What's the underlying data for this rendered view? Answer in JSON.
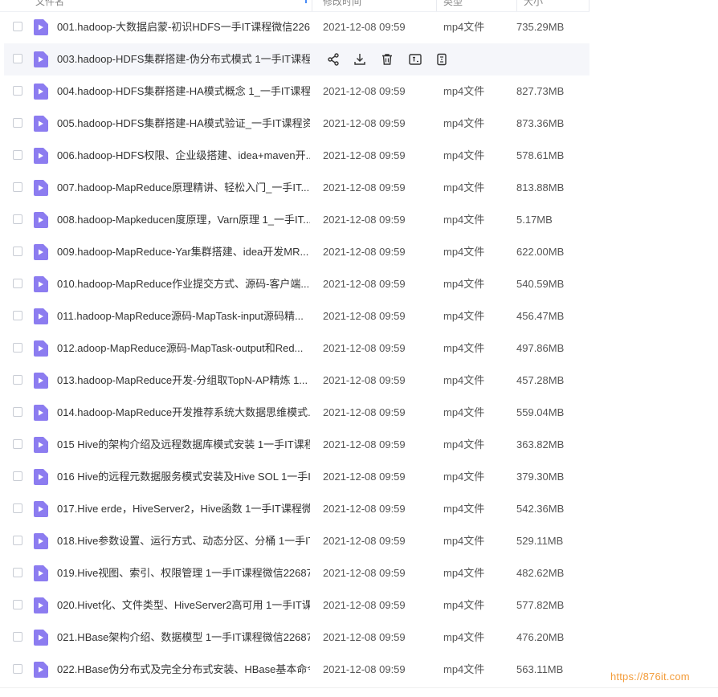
{
  "header": {
    "col_name": "文件名",
    "col_modified": "修改时间",
    "col_type": "类型",
    "col_size": "大小"
  },
  "actions": {
    "share": "share-icon",
    "download": "download-icon",
    "delete": "trash-icon",
    "rename": "rename-icon",
    "more": "more-icon"
  },
  "colors": {
    "file_icon": "#8c7cf0",
    "watermark": "#f39c3a",
    "hover_row": "#f5f6fa"
  },
  "files": [
    {
      "name": "001.hadoop-大数据启蒙-初识HDFS一手IT课程微信226...",
      "date": "2021-12-08 09:59",
      "type": "mp4文件",
      "size": "735.29MB"
    },
    {
      "name": "003.hadoop-HDFS集群搭建-伪分布式模式 1一手IT课程...",
      "date": "",
      "type": "",
      "size": ""
    },
    {
      "name": "004.hadoop-HDFS集群搭建-HA模式概念 1_一手IT课程...",
      "date": "2021-12-08 09:59",
      "type": "mp4文件",
      "size": "827.73MB"
    },
    {
      "name": "005.hadoop-HDFS集群搭建-HA模式验证_一手IT课程资...",
      "date": "2021-12-08 09:59",
      "type": "mp4文件",
      "size": "873.36MB"
    },
    {
      "name": "006.hadoop-HDFS权限、企业级搭建、idea+maven开...",
      "date": "2021-12-08 09:59",
      "type": "mp4文件",
      "size": "578.61MB"
    },
    {
      "name": "007.hadoop-MapReduce原理精讲、轻松入门_一手IT...",
      "date": "2021-12-08 09:59",
      "type": "mp4文件",
      "size": "813.88MB"
    },
    {
      "name": "008.hadoop-Mapkeducen度原理，Varn原理 1_一手IT...",
      "date": "2021-12-08 09:59",
      "type": "mp4文件",
      "size": "5.17MB"
    },
    {
      "name": "009.hadoop-MapReduce-Yar集群搭建、idea开发MR...",
      "date": "2021-12-08 09:59",
      "type": "mp4文件",
      "size": "622.00MB"
    },
    {
      "name": "010.hadoop-MapReduce作业提交方式、源码-客户端...",
      "date": "2021-12-08 09:59",
      "type": "mp4文件",
      "size": "540.59MB"
    },
    {
      "name": "011.hadoop-MapReduce源码-MapTask-input源码精...",
      "date": "2021-12-08 09:59",
      "type": "mp4文件",
      "size": "456.47MB"
    },
    {
      "name": "012.adoop-MapReduce源码-MapTask-output和Red...",
      "date": "2021-12-08 09:59",
      "type": "mp4文件",
      "size": "497.86MB"
    },
    {
      "name": "013.hadoop-MapReduce开发-分组取TopN-AP精炼 1...",
      "date": "2021-12-08 09:59",
      "type": "mp4文件",
      "size": "457.28MB"
    },
    {
      "name": "014.hadoop-MapReduce开发推荐系统大数据思维模式...",
      "date": "2021-12-08 09:59",
      "type": "mp4文件",
      "size": "559.04MB"
    },
    {
      "name": "015 Hive的架构介绍及远程数据库模式安装 1一手IT课程...",
      "date": "2021-12-08 09:59",
      "type": "mp4文件",
      "size": "363.82MB"
    },
    {
      "name": "016 Hive的远程元数据服务模式安装及Hive SOL 1一手IT...",
      "date": "2021-12-08 09:59",
      "type": "mp4文件",
      "size": "379.30MB"
    },
    {
      "name": "017.Hive erde，HiveServer2，Hive函数 1一手IT课程微...",
      "date": "2021-12-08 09:59",
      "type": "mp4文件",
      "size": "542.36MB"
    },
    {
      "name": "018.Hive参数设置、运行方式、动态分区、分桶 1一手IT...",
      "date": "2021-12-08 09:59",
      "type": "mp4文件",
      "size": "529.11MB"
    },
    {
      "name": "019.Hive视图、索引、权限管理 1一手IT课程微信22687...",
      "date": "2021-12-08 09:59",
      "type": "mp4文件",
      "size": "482.62MB"
    },
    {
      "name": "020.Hivet化、文件类型、HiveServer2高可用 1一手IT课...",
      "date": "2021-12-08 09:59",
      "type": "mp4文件",
      "size": "577.82MB"
    },
    {
      "name": "021.HBase架构介绍、数据模型 1一手IT课程微信22687...",
      "date": "2021-12-08 09:59",
      "type": "mp4文件",
      "size": "476.20MB"
    },
    {
      "name": "022.HBase伪分布式及完全分布式安装、HBase基本命令...",
      "date": "2021-12-08 09:59",
      "type": "mp4文件",
      "size": "563.11MB"
    }
  ],
  "watermark": "https://876it.com"
}
